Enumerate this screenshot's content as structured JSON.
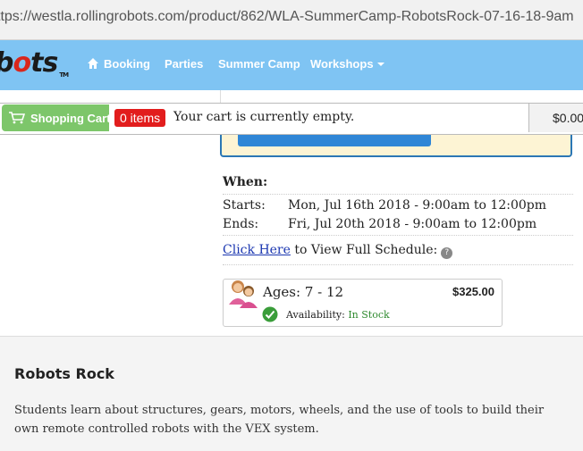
{
  "browser": {
    "url": "ttps://westla.rollingrobots.com/product/862/WLA-SummerCamp-RobotsRock-07-16-18-9am"
  },
  "nav": {
    "logo_pre": "b",
    "logo_o": "o",
    "logo_post": "ts",
    "logo_tm": "TM",
    "items": [
      {
        "label": "Booking",
        "icon": "home-icon"
      },
      {
        "label": "Parties"
      },
      {
        "label": "Summer Camp"
      },
      {
        "label": "Workshops",
        "icon": "caret-down-icon"
      }
    ]
  },
  "cart": {
    "button_label": "Shopping Cart",
    "items_badge": "0 items",
    "message": "Your cart is currently empty.",
    "total": "$0.00"
  },
  "when": {
    "title": "When:",
    "starts_label": "Starts:",
    "starts_value": "Mon, Jul 16th 2018 - 9:00am to 12:00pm",
    "ends_label": "Ends:",
    "ends_value": "Fri, Jul 20th 2018 - 9:00am to 12:00pm",
    "schedule_link": "Click Here",
    "schedule_text": " to View Full Schedule:",
    "help": "?"
  },
  "price_box": {
    "ages": "Ages: 7 - 12",
    "price": "$325.00",
    "availability_label": "Availability:",
    "availability_value": "In Stock"
  },
  "description": {
    "title": "Robots Rock",
    "text": "Students learn about structures, gears, motors, wheels, and the use of tools to build their own remote controlled robots with the VEX system."
  },
  "colors": {
    "nav_bg": "#7fc4f3",
    "cart_green": "#7dc66a",
    "badge_red": "#e21d1d",
    "link_blue": "#1a36b0",
    "in_stock": "#2f8a2f",
    "add_button": "#2f86d6"
  }
}
